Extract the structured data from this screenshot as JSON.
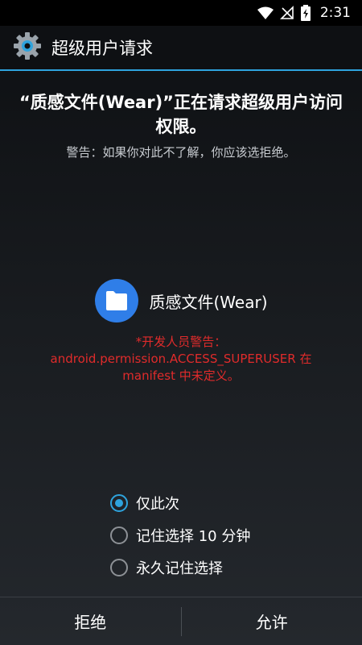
{
  "status_bar": {
    "time": "2:31",
    "icons": [
      "wifi-icon",
      "signal-off-icon",
      "battery-charging-icon"
    ]
  },
  "app_bar": {
    "title": "超级用户请求",
    "icon": "gear-icon",
    "accent_color": "#2ea3dd"
  },
  "request": {
    "title": "“质感文件(Wear)”正在请求超级用户访问权限。",
    "warning": "警告：如果你对此不了解，你应该选拒绝。"
  },
  "app": {
    "name": "质感文件(Wear)",
    "icon": "folder-icon",
    "icon_color": "#2f7ee8"
  },
  "dev_warning": {
    "line1": "*开发人员警告：",
    "line2": "android.permission.ACCESS_SUPERUSER 在",
    "line3": "manifest 中未定义。",
    "color": "#e02b2b"
  },
  "options": [
    {
      "label": "仅此次",
      "checked": true
    },
    {
      "label": "记住选择 10 分钟",
      "checked": false
    },
    {
      "label": "永久记住选择",
      "checked": false
    }
  ],
  "buttons": {
    "deny": "拒绝",
    "allow": "允许"
  }
}
